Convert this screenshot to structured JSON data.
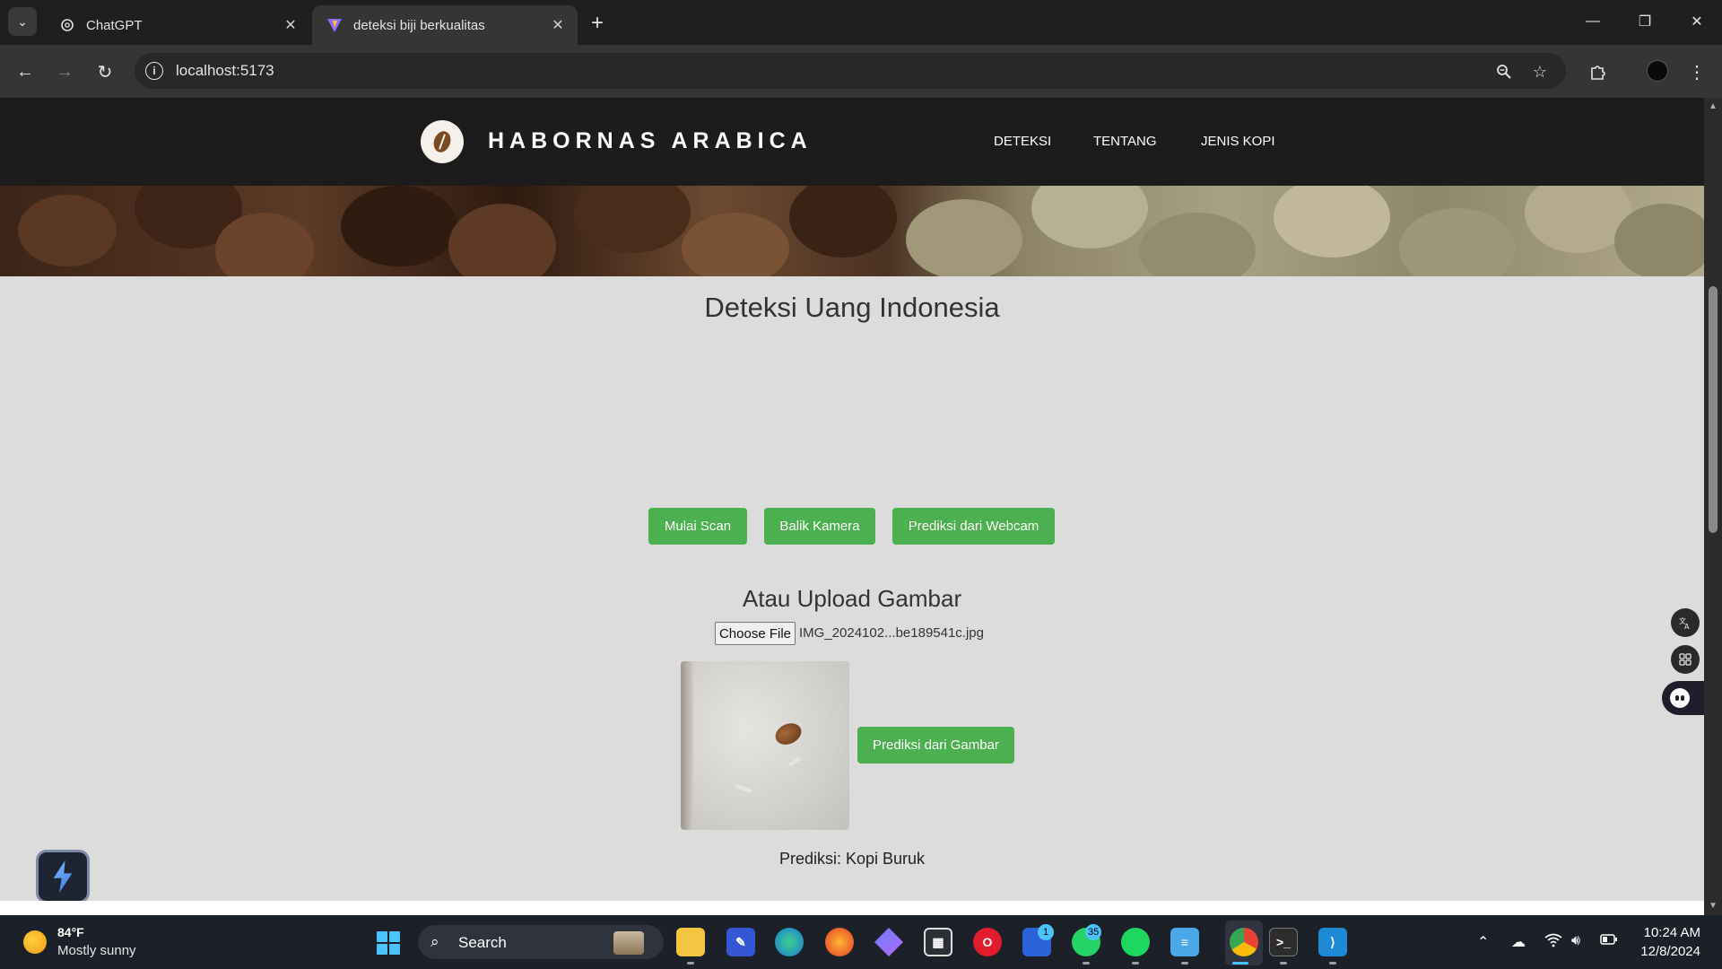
{
  "browser": {
    "tabs": [
      {
        "title": "ChatGPT",
        "active": false
      },
      {
        "title": "deteksi biji berkualitas",
        "active": true
      }
    ],
    "url": "localhost:5173"
  },
  "site": {
    "brand": "HABORNAS ARABICA",
    "nav": [
      "DETEKSI",
      "TENTANG",
      "JENIS KOPI"
    ]
  },
  "main": {
    "title": "Deteksi Uang Indonesia",
    "buttons": {
      "start_scan": "Mulai Scan",
      "flip_camera": "Balik Kamera",
      "predict_webcam": "Prediksi dari Webcam"
    },
    "upload_title": "Atau Upload Gambar",
    "file_button": "Choose File",
    "file_name": "IMG_2024102...be189541c.jpg",
    "predict_image": "Prediksi dari Gambar",
    "prediction": "Prediksi: Kopi Buruk"
  },
  "taskbar": {
    "weather_temp": "84°F",
    "weather_desc": "Mostly sunny",
    "search_label": "Search",
    "badges": {
      "teams": "1",
      "whatsapp": "35"
    },
    "time": "10:24 AM",
    "date": "12/8/2024"
  },
  "colors": {
    "accent_button": "#4caf50",
    "site_nav_bg": "#1c1c1c",
    "page_bg": "#dcdcdc"
  }
}
